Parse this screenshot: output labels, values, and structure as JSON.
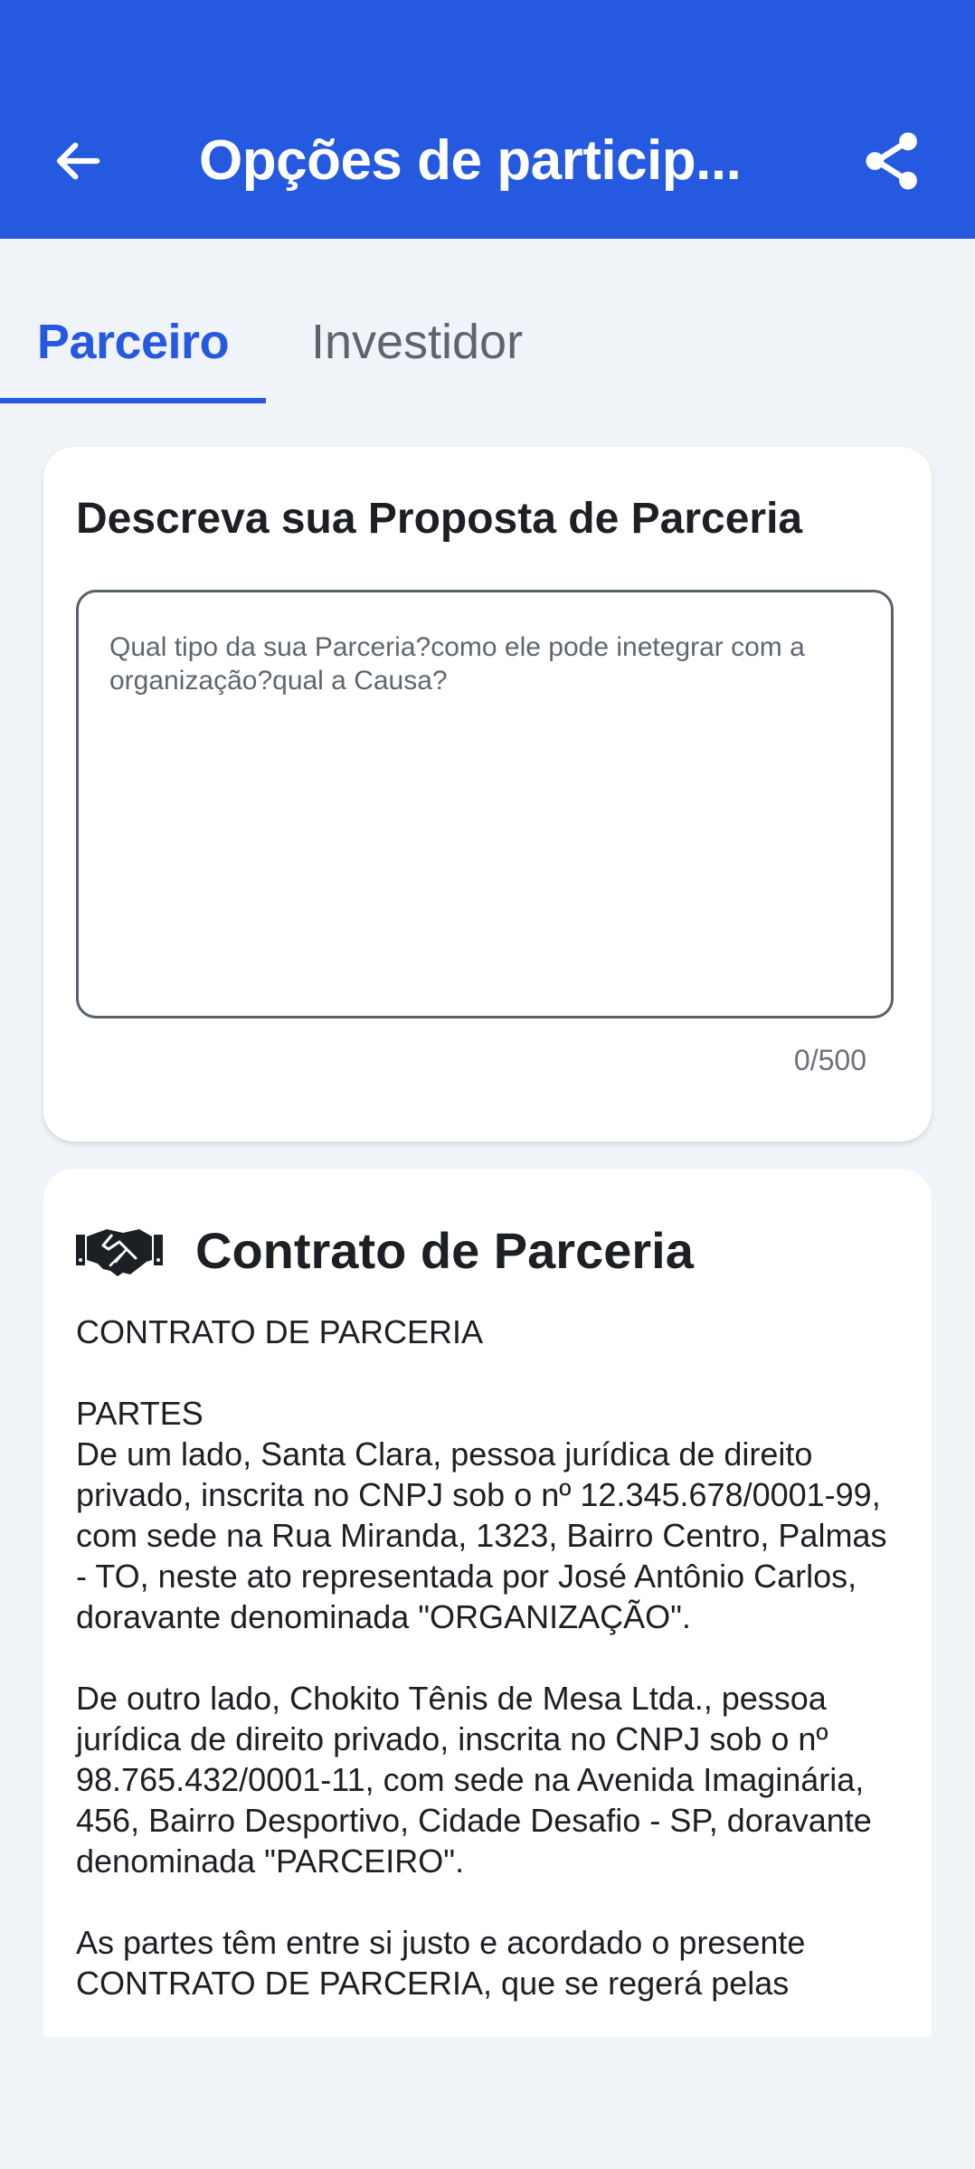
{
  "header": {
    "title": "Opções de particip...",
    "back_icon": "arrow-left-icon",
    "share_icon": "share-icon",
    "background": "#2459e0"
  },
  "tabs": [
    {
      "label": "Parceiro",
      "selected": true
    },
    {
      "label": "Investidor",
      "selected": false
    }
  ],
  "proposal": {
    "title": "Descreva sua Proposta de Parceria",
    "placeholder": "Qual tipo da sua Parceria?como ele pode inetegrar com a organização?qual a Causa?",
    "value": "",
    "counter": "0/500"
  },
  "contract": {
    "icon": "handshake-icon",
    "title": "Contrato de Parceria",
    "paragraphs": [
      "CONTRATO DE PARCERIA",
      "PARTES\nDe um lado, Santa Clara, pessoa jurídica de direito privado, inscrita no CNPJ sob o nº 12.345.678/0001-99, com sede na Rua Miranda, 1323, Bairro Centro, Palmas - TO, neste ato representada por José Antônio Carlos, doravante denominada \"ORGANIZAÇÃO\".",
      "De outro lado, Chokito Tênis de Mesa Ltda., pessoa jurídica de direito privado, inscrita no CNPJ sob o nº 98.765.432/0001-11, com sede na Avenida Imaginária, 456, Bairro Desportivo, Cidade Desafio - SP, doravante denominada \"PARCEIRO\".",
      "As partes têm entre si justo e acordado o presente CONTRATO DE PARCERIA, que se regerá pelas"
    ]
  },
  "colors": {
    "accent": "#2459e0",
    "background": "#f0f3f8",
    "card": "#ffffff",
    "text": "#1c1f24",
    "muted": "#5f6670"
  }
}
